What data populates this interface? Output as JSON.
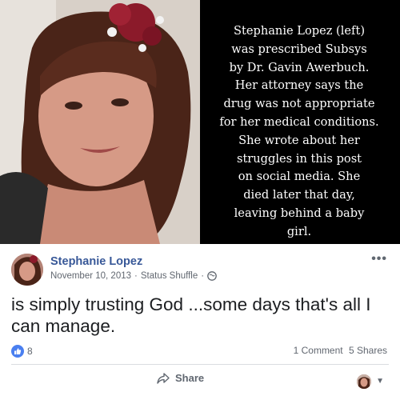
{
  "caption": {
    "text": "Stephanie Lopez (left)\nwas prescribed Subsys\nby Dr. Gavin Awerbuch.\nHer attorney says the\ndrug was not appropriate\nfor her medical conditions.\nShe wrote about her\nstruggles in this post\non social media. She\ndied later that day,\nleaving behind a baby\ngirl."
  },
  "post": {
    "author": "Stephanie Lopez",
    "date": "November 10, 2013",
    "separator": "·",
    "app": "Status Shuffle",
    "separator2": "·",
    "more_glyph": "•••",
    "text": "is simply trusting God ...some days that's all I can manage.",
    "likes_count": "8",
    "comments": "1 Comment",
    "shares": "5 Shares",
    "share_label": "Share",
    "caret": "▼"
  },
  "colors": {
    "name_link": "#385898",
    "meta_gray": "#616770",
    "like_blue": "#4a7ff0",
    "caption_bg": "#000000"
  },
  "icons": [
    "globe-icon",
    "like-icon",
    "share-arrow-icon",
    "more-options-icon",
    "caret-down-icon"
  ]
}
